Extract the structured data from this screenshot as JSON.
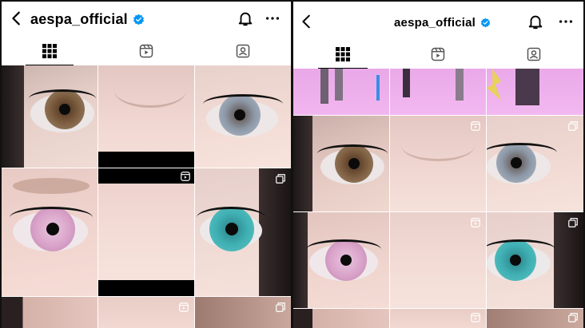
{
  "left_panel": {
    "header": {
      "username": "aespa_official"
    },
    "tabs": [
      "grid",
      "reels",
      "tagged"
    ]
  },
  "right_panel": {
    "header": {
      "username": "aespa_official"
    },
    "tabs": [
      "grid",
      "reels",
      "tagged"
    ]
  },
  "colors": {
    "verified": "#0095f6",
    "skin": "#f2d3cc",
    "iris_brown": "#7a5a3c",
    "iris_gray": "#8d98a7",
    "iris_pink": "#d9a2c9",
    "iris_teal": "#3fb0b4",
    "hair": "#2a2323",
    "pink_banner": "#f1b6ef"
  }
}
